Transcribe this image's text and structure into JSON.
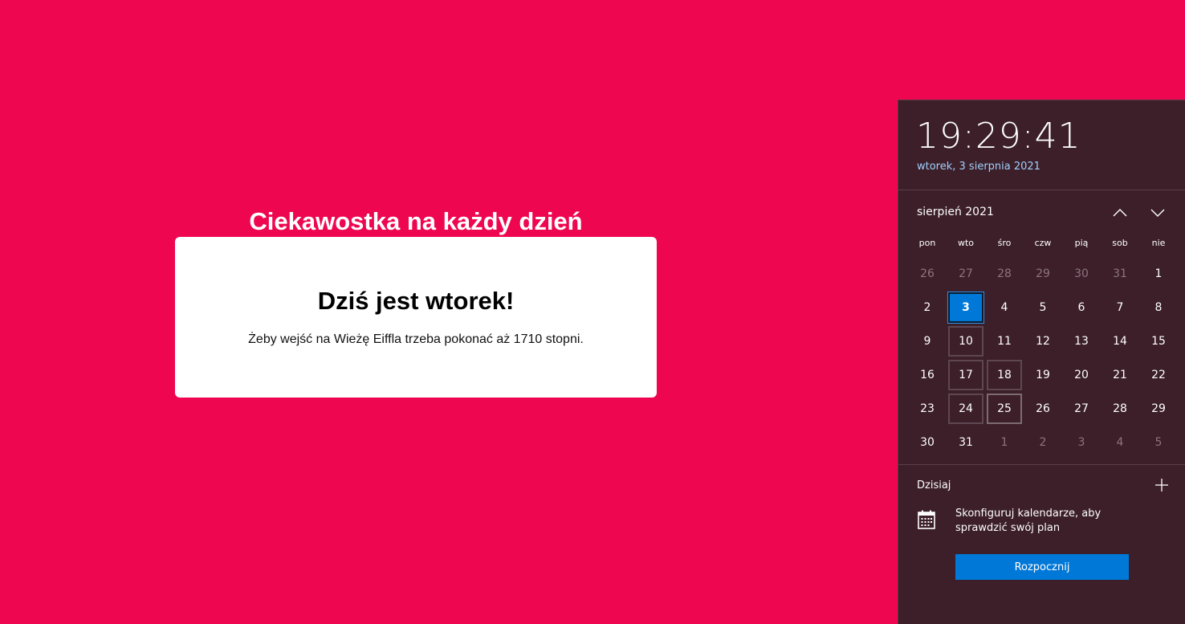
{
  "page": {
    "title": "Ciekawostka na każdy dzień",
    "card_heading": "Dziś jest wtorek!",
    "card_text": "Żeby wejść na Wieżę Eiffla trzeba pokonać aż 1710 stopni."
  },
  "flyout": {
    "time": "19:29:41",
    "date": "wtorek, 3 sierpnia 2021",
    "month": "sierpień 2021",
    "weekdays": [
      "pon",
      "wto",
      "śro",
      "czw",
      "pią",
      "sob",
      "nie"
    ],
    "days": [
      {
        "d": "26",
        "other": true
      },
      {
        "d": "27",
        "other": true
      },
      {
        "d": "28",
        "other": true
      },
      {
        "d": "29",
        "other": true
      },
      {
        "d": "30",
        "other": true
      },
      {
        "d": "31",
        "other": true
      },
      {
        "d": "1"
      },
      {
        "d": "2"
      },
      {
        "d": "3",
        "today": true
      },
      {
        "d": "4"
      },
      {
        "d": "5"
      },
      {
        "d": "6"
      },
      {
        "d": "7"
      },
      {
        "d": "8"
      },
      {
        "d": "9"
      },
      {
        "d": "10",
        "ghost": true
      },
      {
        "d": "11"
      },
      {
        "d": "12"
      },
      {
        "d": "13"
      },
      {
        "d": "14"
      },
      {
        "d": "15"
      },
      {
        "d": "16"
      },
      {
        "d": "17",
        "ghost": true
      },
      {
        "d": "18",
        "ghost": true
      },
      {
        "d": "19"
      },
      {
        "d": "20"
      },
      {
        "d": "21"
      },
      {
        "d": "22"
      },
      {
        "d": "23"
      },
      {
        "d": "24",
        "ghost": true
      },
      {
        "d": "25",
        "hover": true
      },
      {
        "d": "26"
      },
      {
        "d": "27"
      },
      {
        "d": "28"
      },
      {
        "d": "29"
      },
      {
        "d": "30"
      },
      {
        "d": "31"
      },
      {
        "d": "1",
        "other": true
      },
      {
        "d": "2",
        "other": true
      },
      {
        "d": "3",
        "other": true
      },
      {
        "d": "4",
        "other": true
      },
      {
        "d": "5",
        "other": true
      }
    ],
    "agenda_label": "Dzisiaj",
    "config_text": "Skonfiguruj kalendarze, aby sprawdzić swój plan",
    "start_button": "Rozpocznij",
    "icons": {
      "prev": "chevron-up-icon",
      "next": "chevron-down-icon",
      "add": "plus-icon",
      "calendar": "calendar-icon"
    }
  },
  "colors": {
    "background": "#ee0750",
    "flyout_bg": "#3c1f29",
    "accent": "#0078d7",
    "date_link": "#9fd0ff"
  }
}
